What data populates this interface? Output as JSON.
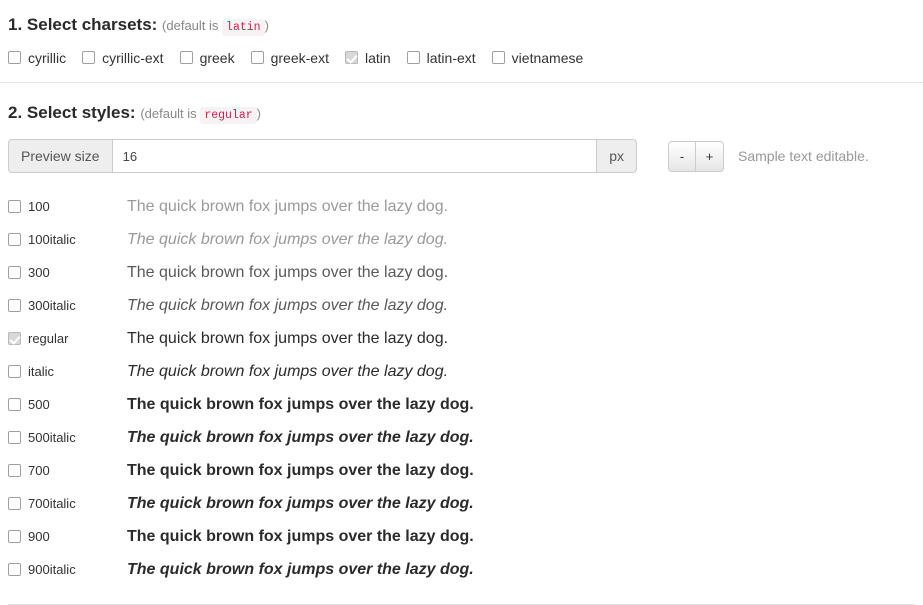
{
  "charsets": {
    "heading": "1. Select charsets:",
    "default_prefix": "(default is",
    "default_code": "latin",
    "default_suffix": ")",
    "items": [
      {
        "label": "cyrillic",
        "checked": false,
        "disabled": false
      },
      {
        "label": "cyrillic-ext",
        "checked": false,
        "disabled": false
      },
      {
        "label": "greek",
        "checked": false,
        "disabled": false
      },
      {
        "label": "greek-ext",
        "checked": false,
        "disabled": false
      },
      {
        "label": "latin",
        "checked": true,
        "disabled": true
      },
      {
        "label": "latin-ext",
        "checked": false,
        "disabled": false
      },
      {
        "label": "vietnamese",
        "checked": false,
        "disabled": false
      }
    ]
  },
  "styles": {
    "heading": "2. Select styles:",
    "default_prefix": "(default is",
    "default_code": "regular",
    "default_suffix": ")",
    "preview": {
      "addon_label": "Preview size",
      "value": "16",
      "placeholder": "16",
      "unit_label": "px",
      "decrease_label": "-",
      "increase_label": "+",
      "note": "Sample text editable."
    },
    "sample_text": "The quick brown fox jumps over the lazy dog.",
    "rows": [
      {
        "label": "100",
        "checked": false,
        "disabled": false,
        "weight": 100,
        "italic": false
      },
      {
        "label": "100italic",
        "checked": false,
        "disabled": false,
        "weight": 100,
        "italic": true
      },
      {
        "label": "300",
        "checked": false,
        "disabled": false,
        "weight": 300,
        "italic": false
      },
      {
        "label": "300italic",
        "checked": false,
        "disabled": false,
        "weight": 300,
        "italic": true
      },
      {
        "label": "regular",
        "checked": true,
        "disabled": true,
        "weight": 400,
        "italic": false
      },
      {
        "label": "italic",
        "checked": false,
        "disabled": false,
        "weight": 400,
        "italic": true
      },
      {
        "label": "500",
        "checked": false,
        "disabled": false,
        "weight": 500,
        "italic": false
      },
      {
        "label": "500italic",
        "checked": false,
        "disabled": false,
        "weight": 500,
        "italic": true
      },
      {
        "label": "700",
        "checked": false,
        "disabled": false,
        "weight": 700,
        "italic": false
      },
      {
        "label": "700italic",
        "checked": false,
        "disabled": false,
        "weight": 700,
        "italic": true
      },
      {
        "label": "900",
        "checked": false,
        "disabled": false,
        "weight": 900,
        "italic": false
      },
      {
        "label": "900italic",
        "checked": false,
        "disabled": false,
        "weight": 900,
        "italic": true
      }
    ]
  },
  "colors": {
    "code_text": "#c7254e",
    "code_bg": "#f9f2f4",
    "text": "#333333",
    "muted": "#888888",
    "divider": "#e5e5e5"
  }
}
